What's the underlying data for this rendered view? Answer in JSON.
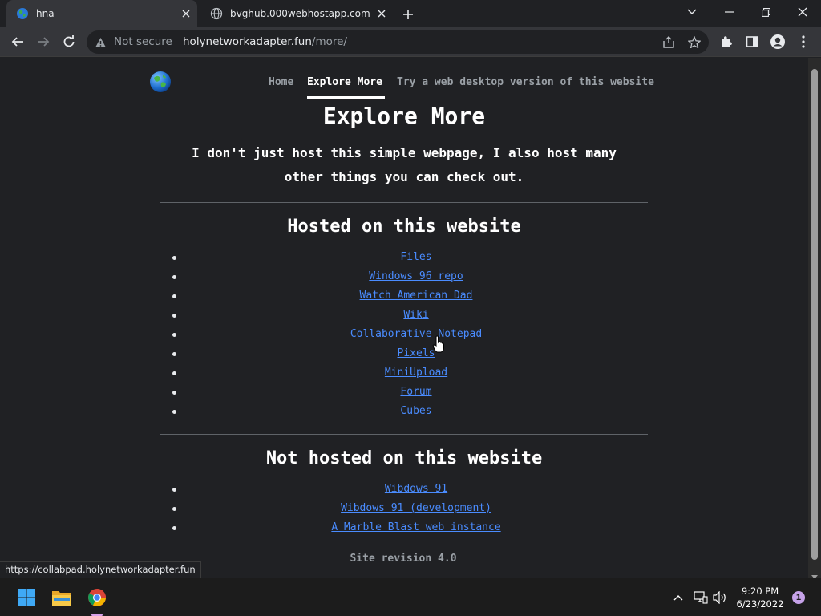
{
  "browser": {
    "tabs": [
      {
        "title": "hna",
        "favicon": "globe-favicon",
        "active": true
      },
      {
        "title": "bvghub.000webhostapp.com",
        "favicon": "web-icon",
        "active": false
      }
    ],
    "security_label": "Not secure",
    "url_host": "holynetworkadapter.fun",
    "url_path": "/more/",
    "status_url": "https://collabpad.holynetworkadapter.fun"
  },
  "page": {
    "nav": {
      "home": "Home",
      "explore_more": "Explore More",
      "desktop": "Try a web desktop version of this website"
    },
    "title": "Explore More",
    "intro_line1": "I don't just host this simple webpage, I also host many",
    "intro_line2": "other things you can check out.",
    "hosted_heading": "Hosted on this website",
    "hosted_links": [
      "Files",
      "Windows 96 repo",
      "Watch American Dad",
      "Wiki",
      "Collaborative Notepad",
      "Pixels",
      "MiniUpload",
      "Forum",
      "Cubes"
    ],
    "not_hosted_heading": "Not hosted on this website",
    "not_hosted_links": [
      "Wibdows 91",
      "Wibdows 91 (development)",
      "A Marble Blast web instance"
    ],
    "revision": "Site revision 4.0"
  },
  "taskbar": {
    "pinned": [
      "windows-start-icon",
      "file-explorer-icon",
      "chrome-icon"
    ],
    "time": "9:20 PM",
    "date": "6/23/2022",
    "notification_count": "1"
  },
  "colors": {
    "page_bg": "#202124",
    "link": "#4a8cff",
    "toolbar": "#35363a"
  }
}
